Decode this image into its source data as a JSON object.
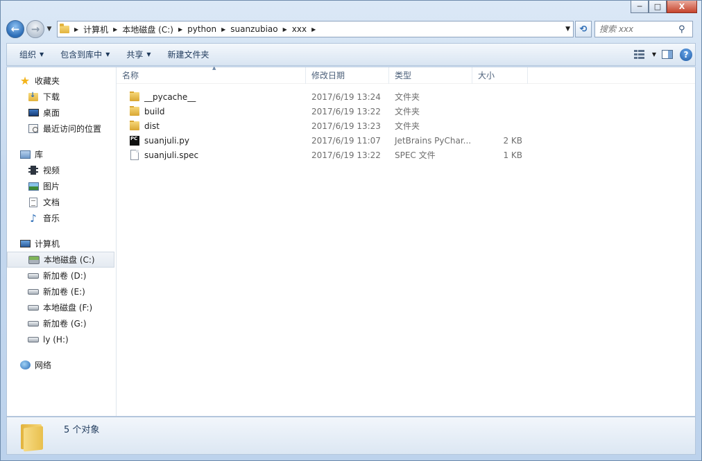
{
  "window": {
    "controls": {
      "minimize": "─",
      "maximize": "□",
      "close": "X"
    }
  },
  "address": {
    "breadcrumbs": [
      "计算机",
      "本地磁盘 (C:)",
      "python",
      "suanzubiao",
      "xxx"
    ],
    "search_placeholder": "搜索 xxx"
  },
  "toolbar": {
    "organize": "组织",
    "include_in_library": "包含到库中",
    "share": "共享",
    "new_folder": "新建文件夹"
  },
  "sidebar": {
    "favorites": {
      "header": "收藏夹",
      "items": [
        "下载",
        "桌面",
        "最近访问的位置"
      ]
    },
    "libraries": {
      "header": "库",
      "items": [
        "视频",
        "图片",
        "文档",
        "音乐"
      ]
    },
    "computer": {
      "header": "计算机",
      "items": [
        "本地磁盘 (C:)",
        "新加卷 (D:)",
        "新加卷 (E:)",
        "本地磁盘 (F:)",
        "新加卷 (G:)",
        "ly (H:)"
      ]
    },
    "network": {
      "header": "网络"
    }
  },
  "columns": {
    "name": "名称",
    "date": "修改日期",
    "type": "类型",
    "size": "大小"
  },
  "files": [
    {
      "name": "__pycache__",
      "date": "2017/6/19 13:24",
      "type": "文件夹",
      "size": "",
      "icon": "folder-icon"
    },
    {
      "name": "build",
      "date": "2017/6/19 13:22",
      "type": "文件夹",
      "size": "",
      "icon": "folder-icon"
    },
    {
      "name": "dist",
      "date": "2017/6/19 13:23",
      "type": "文件夹",
      "size": "",
      "icon": "folder-icon"
    },
    {
      "name": "suanjuli.py",
      "date": "2017/6/19 11:07",
      "type": "JetBrains PyChar...",
      "size": "2 KB",
      "icon": "pycharm-file-icon"
    },
    {
      "name": "suanjuli.spec",
      "date": "2017/6/19 13:22",
      "type": "SPEC 文件",
      "size": "1 KB",
      "icon": "generic-file-icon"
    }
  ],
  "status": {
    "item_count": "5 个对象"
  }
}
